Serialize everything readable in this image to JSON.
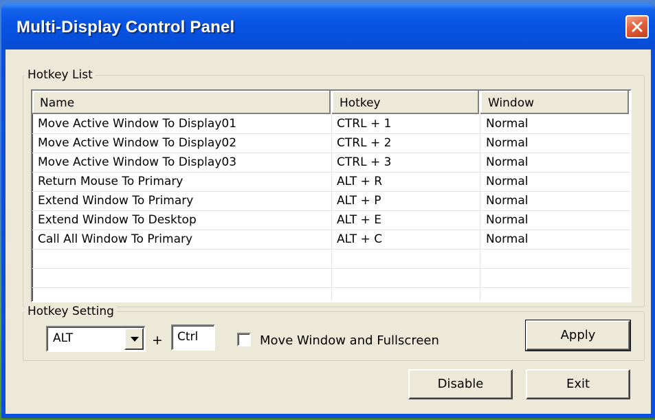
{
  "window": {
    "title": "Multi-Display Control Panel"
  },
  "hotkey_list": {
    "label": "Hotkey List",
    "columns": [
      "Name",
      "Hotkey",
      "Window"
    ],
    "rows": [
      {
        "name": "Move Active Window To Display01",
        "hotkey": "CTRL + 1",
        "window": "Normal"
      },
      {
        "name": "Move Active Window To Display02",
        "hotkey": "CTRL + 2",
        "window": "Normal"
      },
      {
        "name": "Move Active Window To Display03",
        "hotkey": "CTRL + 3",
        "window": "Normal"
      },
      {
        "name": "Return Mouse To Primary",
        "hotkey": "ALT + R",
        "window": "Normal"
      },
      {
        "name": "Extend Window To Primary",
        "hotkey": "ALT + P",
        "window": "Normal"
      },
      {
        "name": "Extend Window To Desktop",
        "hotkey": "ALT + E",
        "window": "Normal"
      },
      {
        "name": "Call All Window To Primary",
        "hotkey": "ALT + C",
        "window": "Normal"
      }
    ]
  },
  "hotkey_setting": {
    "label": "Hotkey Setting",
    "modifier_value": "ALT",
    "plus": "+",
    "key_value": "Ctrl",
    "checkbox_label": "Move Window and Fullscreen",
    "checkbox_checked": false,
    "apply_label": "Apply"
  },
  "footer": {
    "disable_label": "Disable",
    "exit_label": "Exit"
  },
  "colors": {
    "titlebar": "#0a55e6",
    "close_button": "#e4613e",
    "face": "#ece9d8"
  }
}
